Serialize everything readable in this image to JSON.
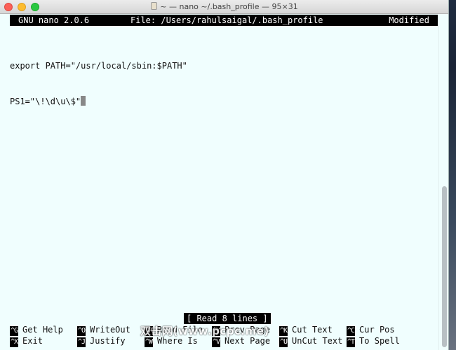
{
  "window": {
    "title": "~ — nano ~/.bash_profile — 95×31"
  },
  "nano": {
    "version": "GNU nano 2.0.6",
    "file": "File: /Users/rahulsaigal/.bash_profile",
    "state": "Modified"
  },
  "editor": {
    "lines": [
      "export PATH=\"/usr/local/sbin:$PATH\"",
      "PS1=\"\\!\\d\\u\\$\""
    ]
  },
  "status_message": "[ Read 8 lines ]",
  "shortcuts": [
    {
      "key": "^G",
      "label": "Get Help"
    },
    {
      "key": "^X",
      "label": "Exit"
    },
    {
      "key": "^O",
      "label": "WriteOut"
    },
    {
      "key": "^J",
      "label": "Justify"
    },
    {
      "key": "^R",
      "label": "Read File"
    },
    {
      "key": "^W",
      "label": "Where Is"
    },
    {
      "key": "^Y",
      "label": "Prev Page"
    },
    {
      "key": "^V",
      "label": "Next Page"
    },
    {
      "key": "^K",
      "label": "Cut Text"
    },
    {
      "key": "^U",
      "label": "UnCut Text"
    },
    {
      "key": "^C",
      "label": "Cur Pos"
    },
    {
      "key": "^T",
      "label": "To Spell"
    }
  ],
  "watermark": "双击网(www.pcpc.me)",
  "colors": {
    "terminal_background": "#f0fefe",
    "inverse_bar": "#000000"
  }
}
